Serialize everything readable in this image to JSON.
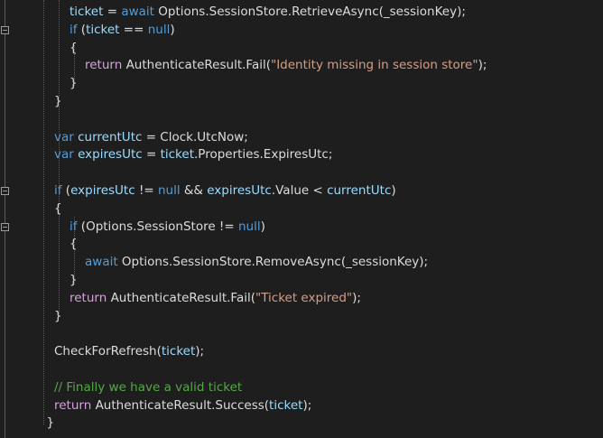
{
  "editor": {
    "language": "C#",
    "theme": "dark",
    "lines": [
      {
        "indent": 2,
        "segs": [
          [
            "var",
            "ticket"
          ],
          [
            "op",
            " = "
          ],
          [
            "kw",
            "await"
          ],
          [
            "ty",
            " Options.SessionStore.RetrieveAsync(_sessionKey);"
          ]
        ]
      },
      {
        "indent": 2,
        "fold": true,
        "segs": [
          [
            "kw",
            "if"
          ],
          [
            "ty",
            " ("
          ],
          [
            "var",
            "ticket"
          ],
          [
            "ty",
            " == "
          ],
          [
            "kw",
            "null"
          ],
          [
            "ty",
            ")"
          ]
        ]
      },
      {
        "indent": 2,
        "segs": [
          [
            "ty",
            "{"
          ]
        ]
      },
      {
        "indent": 3,
        "segs": [
          [
            "ctl",
            "return"
          ],
          [
            "ty",
            " AuthenticateResult.Fail("
          ],
          [
            "str",
            "\"Identity missing in session store\""
          ],
          [
            "ty",
            ");"
          ]
        ]
      },
      {
        "indent": 2,
        "segs": [
          [
            "ty",
            "}"
          ]
        ]
      },
      {
        "indent": 1,
        "segs": [
          [
            "ty",
            "}"
          ]
        ]
      },
      {
        "indent": 0,
        "segs": []
      },
      {
        "indent": 1,
        "segs": [
          [
            "kw",
            "var"
          ],
          [
            "ty",
            " "
          ],
          [
            "var",
            "currentUtc"
          ],
          [
            "ty",
            " = Clock.UtcNow;"
          ]
        ]
      },
      {
        "indent": 1,
        "segs": [
          [
            "kw",
            "var"
          ],
          [
            "ty",
            " "
          ],
          [
            "var",
            "expiresUtc"
          ],
          [
            "ty",
            " = "
          ],
          [
            "var",
            "ticket"
          ],
          [
            "ty",
            ".Properties.ExpiresUtc;"
          ]
        ]
      },
      {
        "indent": 0,
        "segs": []
      },
      {
        "indent": 1,
        "fold": true,
        "segs": [
          [
            "kw",
            "if"
          ],
          [
            "ty",
            " ("
          ],
          [
            "var",
            "expiresUtc"
          ],
          [
            "ty",
            " != "
          ],
          [
            "kw",
            "null"
          ],
          [
            "ty",
            " && "
          ],
          [
            "var",
            "expiresUtc"
          ],
          [
            "ty",
            ".Value < "
          ],
          [
            "var",
            "currentUtc"
          ],
          [
            "ty",
            ")"
          ]
        ]
      },
      {
        "indent": 1,
        "segs": [
          [
            "ty",
            "{"
          ]
        ]
      },
      {
        "indent": 2,
        "fold": true,
        "segs": [
          [
            "kw",
            "if"
          ],
          [
            "ty",
            " (Options.SessionStore != "
          ],
          [
            "kw",
            "null"
          ],
          [
            "ty",
            ")"
          ]
        ]
      },
      {
        "indent": 2,
        "segs": [
          [
            "ty",
            "{"
          ]
        ]
      },
      {
        "indent": 3,
        "segs": [
          [
            "kw",
            "await"
          ],
          [
            "ty",
            " Options.SessionStore.RemoveAsync(_sessionKey);"
          ]
        ]
      },
      {
        "indent": 2,
        "segs": [
          [
            "ty",
            "}"
          ]
        ]
      },
      {
        "indent": 2,
        "segs": [
          [
            "ctl",
            "return"
          ],
          [
            "ty",
            " AuthenticateResult.Fail("
          ],
          [
            "str",
            "\"Ticket expired\""
          ],
          [
            "ty",
            ");"
          ]
        ]
      },
      {
        "indent": 1,
        "segs": [
          [
            "ty",
            "}"
          ]
        ]
      },
      {
        "indent": 0,
        "segs": []
      },
      {
        "indent": 1,
        "segs": [
          [
            "ty",
            "CheckForRefresh("
          ],
          [
            "var",
            "ticket"
          ],
          [
            "ty",
            ");"
          ]
        ]
      },
      {
        "indent": 0,
        "segs": []
      },
      {
        "indent": 1,
        "segs": [
          [
            "cm",
            "// Finally we have a valid ticket"
          ]
        ]
      },
      {
        "indent": 1,
        "segs": [
          [
            "ctl",
            "return"
          ],
          [
            "ty",
            " AuthenticateResult.Success("
          ],
          [
            "var",
            "ticket"
          ],
          [
            "ty",
            ");"
          ]
        ]
      },
      {
        "indent": 0.5,
        "segs": [
          [
            "ty",
            "}"
          ]
        ]
      }
    ]
  }
}
